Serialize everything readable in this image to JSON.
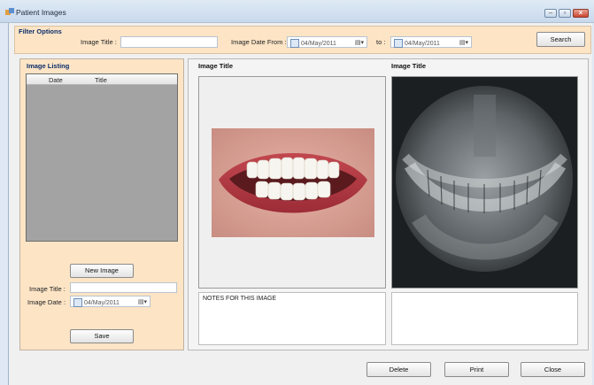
{
  "window": {
    "title": "Patient Images"
  },
  "filter": {
    "group_title": "Filter Options",
    "image_title_label": "Image Title :",
    "image_title_value": "",
    "date_from_label": "Image Date From :",
    "date_from_value": "04/May/2011",
    "to_label": "to :",
    "date_to_value": "04/May/2011",
    "search_label": "Search"
  },
  "listing": {
    "group_title": "Image Listing",
    "columns": [
      "Date",
      "Title"
    ],
    "new_image_label": "New Image",
    "image_title_label": "Image Title :",
    "image_title_value": "",
    "image_date_label": "Image Date :",
    "image_date_value": "04/May/2011",
    "save_label": "Save"
  },
  "viewer": {
    "left_title": "Image Title",
    "right_title": "Image Title",
    "left_notes": "NOTES FOR THIS IMAGE",
    "right_notes": ""
  },
  "footer": {
    "delete_label": "Delete",
    "print_label": "Print",
    "close_label": "Close"
  }
}
